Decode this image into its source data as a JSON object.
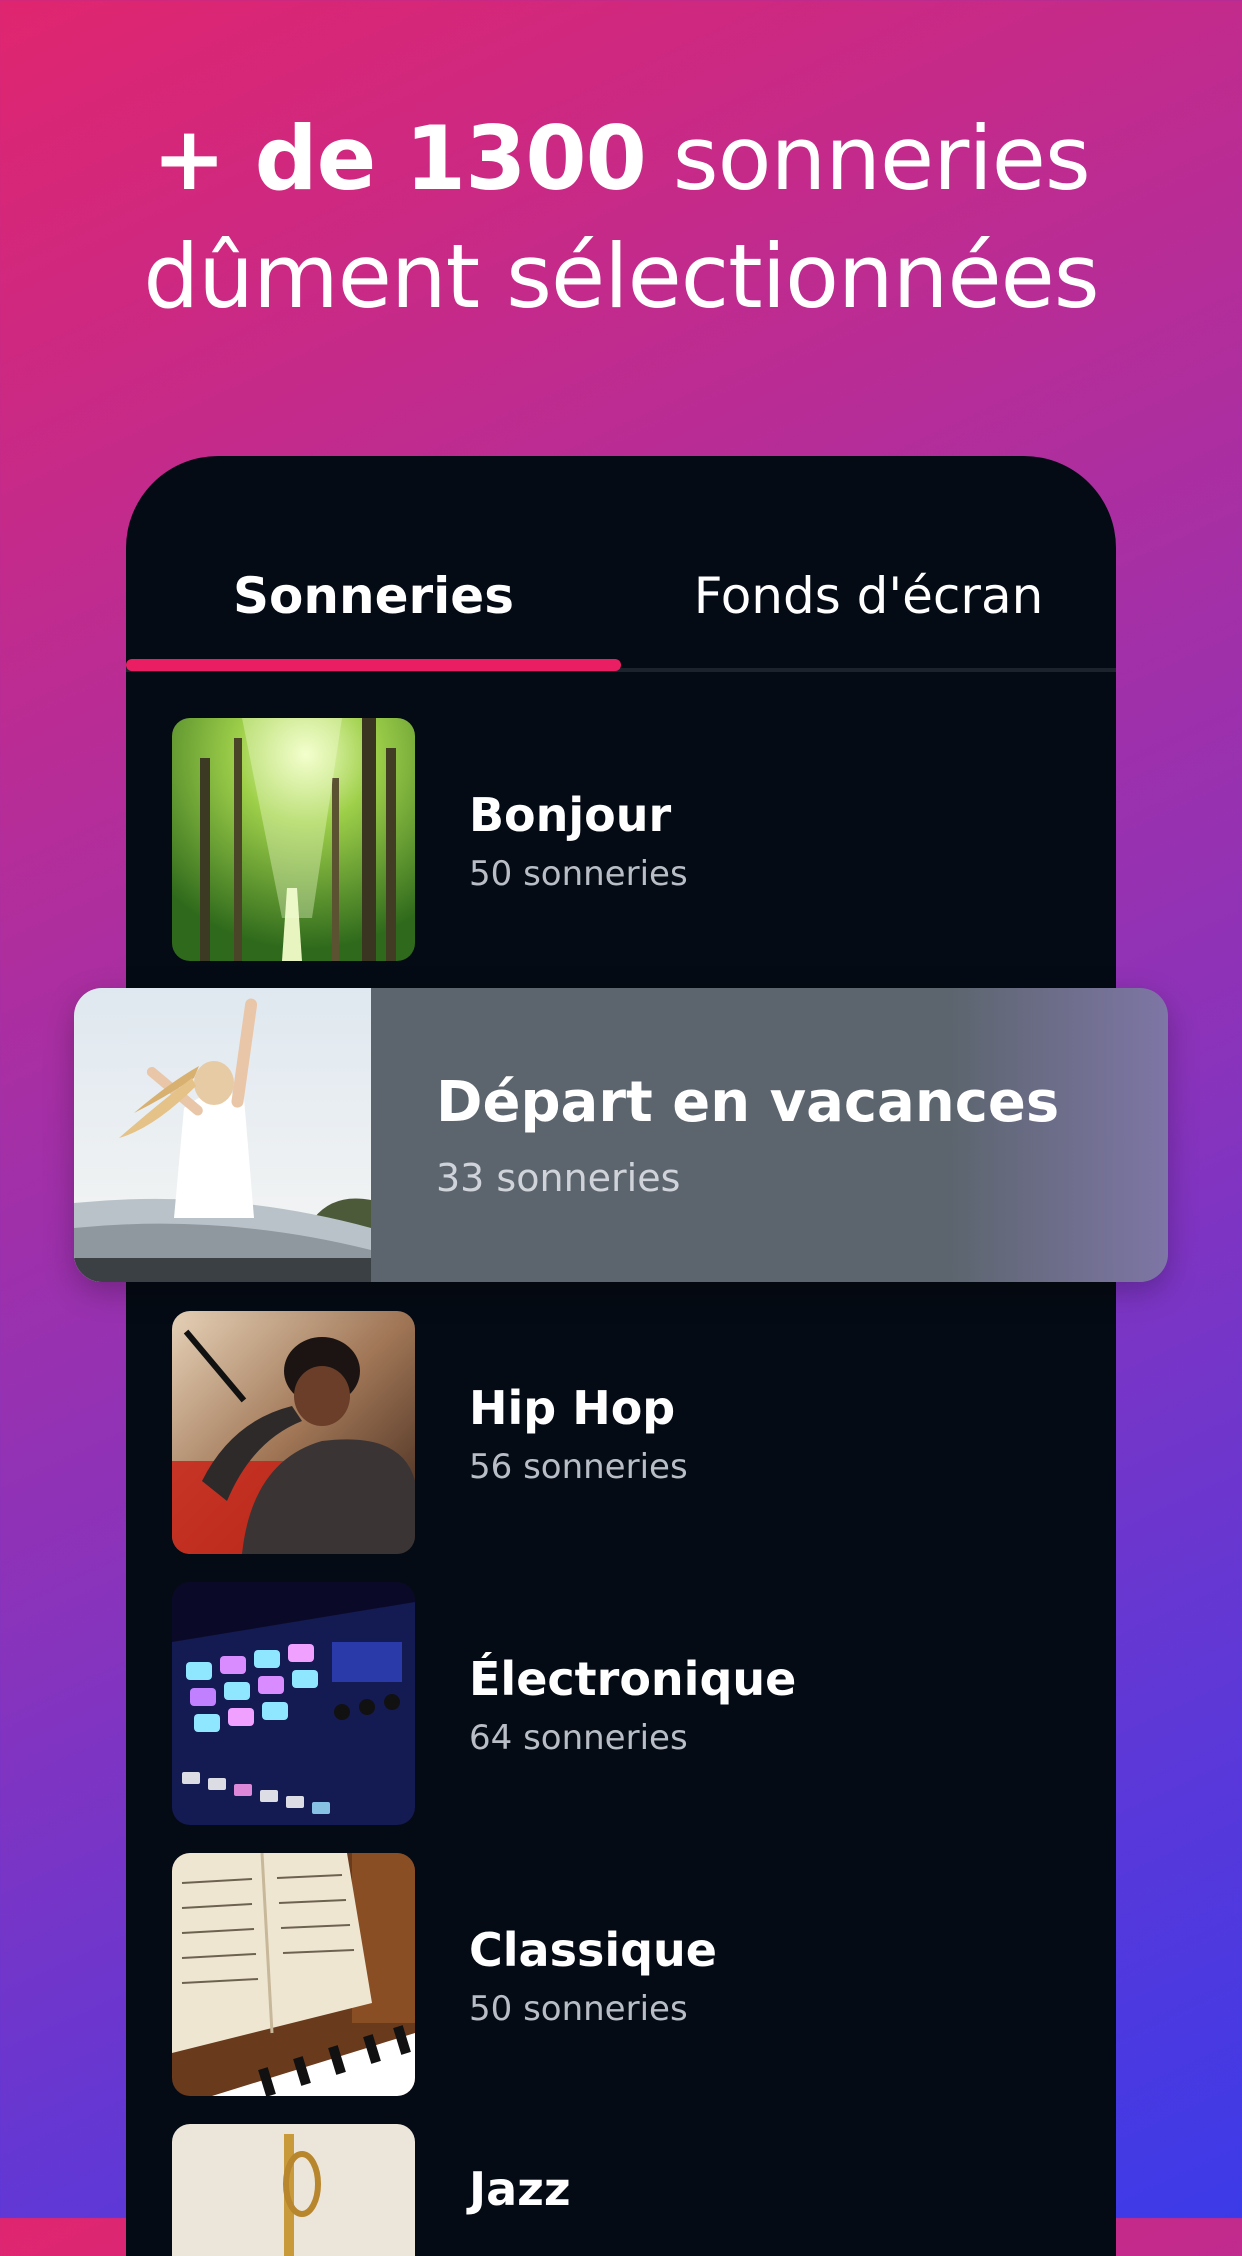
{
  "headline": {
    "bold_part": "+ de 1300",
    "rest_line1": " sonneries",
    "line2": "dûment sélectionnées"
  },
  "tabs": [
    {
      "label": "Sonneries",
      "active": true
    },
    {
      "label": "Fonds d'écran",
      "active": false
    }
  ],
  "categories": [
    {
      "title": "Bonjour",
      "count": "50 sonneries",
      "image": "forest-sunlight-image"
    },
    {
      "title": "Départ en vacances",
      "count": "33 sonneries",
      "image": "woman-on-car-roof-image",
      "highlighted": true
    },
    {
      "title": "Hip Hop",
      "count": "56 sonneries",
      "image": "rapper-singing-image"
    },
    {
      "title": "Électronique",
      "count": "64 sonneries",
      "image": "drum-pad-controller-image"
    },
    {
      "title": "Classique",
      "count": "50 sonneries",
      "image": "piano-sheet-music-image"
    },
    {
      "title": "Jazz",
      "count": "",
      "image": "trumpet-image"
    }
  ],
  "colors": {
    "accent": "#ea1f63",
    "phone_bg": "#050b14",
    "highlight_bg": "#5c656e"
  }
}
